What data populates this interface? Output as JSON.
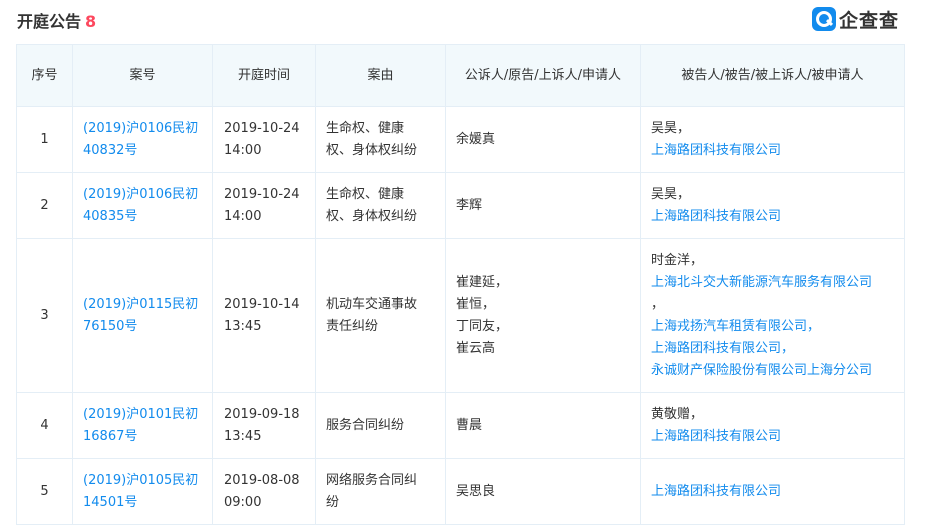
{
  "header": {
    "title": "开庭公告",
    "count": "8",
    "logo_text": "企查查"
  },
  "table": {
    "columns": [
      "序号",
      "案号",
      "开庭时间",
      "案由",
      "公诉人/原告/上诉人/申请人",
      "被告人/被告/被上诉人/被申请人"
    ],
    "rows": [
      {
        "no": "1",
        "case_no": [
          "(2019)沪0106民初",
          "40832号"
        ],
        "time": [
          "2019-10-24",
          "14:00"
        ],
        "cause": [
          "生命权、健康",
          "权、身体权纠纷"
        ],
        "plaintiffs": [
          "余媛真"
        ],
        "defendants": [
          {
            "text": "吴昊，",
            "link": false
          },
          {
            "text": "上海路团科技有限公司",
            "link": true
          }
        ]
      },
      {
        "no": "2",
        "case_no": [
          "(2019)沪0106民初",
          "40835号"
        ],
        "time": [
          "2019-10-24",
          "14:00"
        ],
        "cause": [
          "生命权、健康",
          "权、身体权纠纷"
        ],
        "plaintiffs": [
          "李辉"
        ],
        "defendants": [
          {
            "text": "吴昊，",
            "link": false
          },
          {
            "text": "上海路团科技有限公司",
            "link": true
          }
        ]
      },
      {
        "no": "3",
        "case_no": [
          "(2019)沪0115民初",
          "76150号"
        ],
        "time": [
          "2019-10-14",
          "13:45"
        ],
        "cause": [
          "机动车交通事故",
          "责任纠纷"
        ],
        "plaintiffs": [
          "崔建延，",
          "崔恒，",
          "丁同友，",
          "崔云高"
        ],
        "defendants": [
          {
            "text": "时金洋，",
            "link": false
          },
          {
            "text": "上海北斗交大新能源汽车服务有限公司",
            "link": true
          },
          {
            "text": "，",
            "link": false
          },
          {
            "text": "上海戎扬汽车租赁有限公司，",
            "link": true
          },
          {
            "text": "上海路团科技有限公司，",
            "link": true
          },
          {
            "text": "永诚财产保险股份有限公司上海分公司",
            "link": true
          }
        ]
      },
      {
        "no": "4",
        "case_no": [
          "(2019)沪0101民初",
          "16867号"
        ],
        "time": [
          "2019-09-18",
          "13:45"
        ],
        "cause": [
          "服务合同纠纷"
        ],
        "plaintiffs": [
          "曹晨"
        ],
        "defendants": [
          {
            "text": "黄敬赠，",
            "link": false
          },
          {
            "text": "上海路团科技有限公司",
            "link": true
          }
        ]
      },
      {
        "no": "5",
        "case_no": [
          "(2019)沪0105民初",
          "14501号"
        ],
        "time": [
          "2019-08-08",
          "09:00"
        ],
        "cause": [
          "网络服务合同纠",
          "纷"
        ],
        "plaintiffs": [
          "吴思良"
        ],
        "defendants": [
          {
            "text": "上海路团科技有限公司",
            "link": true
          }
        ]
      }
    ]
  }
}
